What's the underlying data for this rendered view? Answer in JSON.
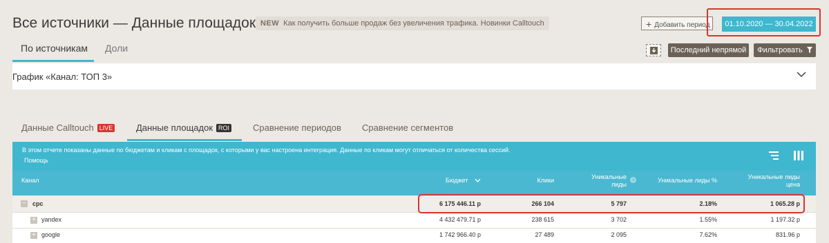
{
  "header": {
    "title": "Все источники — Данные площадок",
    "news_tag": "NEW",
    "news_text": "Как получить больше продаж без увеличения трафика. Новинки Calltouch",
    "add_period_label": "Добавить период",
    "date_range": "01.10.2020  —  30.04.2022"
  },
  "mode_tabs": [
    "По источникам",
    "Доли"
  ],
  "toolbar": {
    "download_icon": "download-icon",
    "last_indirect_label": "Последний непрямой",
    "filter_label": "Фильтровать",
    "filter_icon": "funnel-icon"
  },
  "chart_panel": {
    "title": "График «Канал: ТОП 3»",
    "toggle_icon": "chevron-down-icon"
  },
  "report_tabs": [
    {
      "label": "Данные Calltouch",
      "badge": "LIVE"
    },
    {
      "label": "Данные площадок",
      "badge": "ROI"
    },
    {
      "label": "Сравнение периодов",
      "badge": ""
    },
    {
      "label": "Сравнение сегментов",
      "badge": ""
    }
  ],
  "info": {
    "text": "В этом отчете показаны данные по бюджетам и кликам с площадок, с которыми у вас настроена интеграция. Данные по кликам могут отличаться от количества сессий.",
    "help_label": "Помощь"
  },
  "table": {
    "columns": {
      "channel": "Канал",
      "budget": "Бюджет",
      "clicks": "Клики",
      "unique_leads_line1": "Уникальные",
      "unique_leads_line2": "лиды",
      "unique_leads_pct": "Уникальные лиды %",
      "unique_leads_price_line1": "Уникальные лиды",
      "unique_leads_price_line2": "цена"
    },
    "rows": [
      {
        "channel": "cpc",
        "toggle": "−",
        "budget": "6 175 446.11 р",
        "clicks": "266 104",
        "unique_leads": "5 797",
        "unique_leads_pct": "2.18%",
        "unique_leads_price": "1 065.28 р"
      },
      {
        "channel": "yandex",
        "toggle": "+",
        "budget": "4 432 479.71 р",
        "clicks": "238 615",
        "unique_leads": "3 702",
        "unique_leads_pct": "1.55%",
        "unique_leads_price": "1 197.32 р"
      },
      {
        "channel": "google",
        "toggle": "+",
        "budget": "1 742 966.40 р",
        "clicks": "27 489",
        "unique_leads": "2 095",
        "unique_leads_pct": "7.62%",
        "unique_leads_price": "831.96 р"
      }
    ]
  },
  "colors": {
    "accent": "#3fb7cf",
    "highlight": "#d9332f",
    "dark_button": "#6b6157",
    "background": "#ece9e4"
  }
}
